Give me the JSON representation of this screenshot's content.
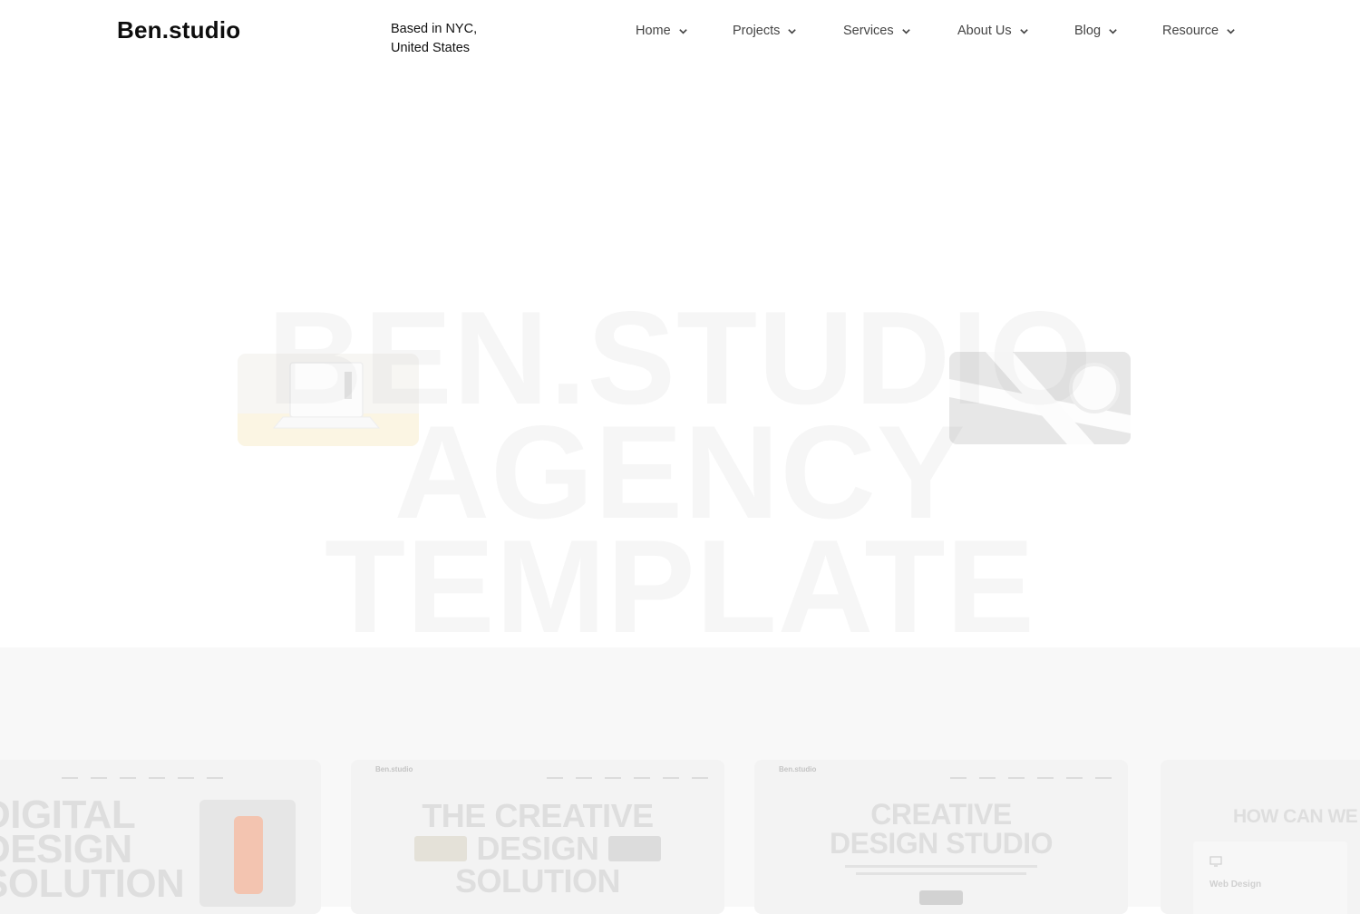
{
  "header": {
    "logo": "Ben.studio",
    "location_line1": "Based in NYC,",
    "location_line2": "United States"
  },
  "nav": [
    {
      "label": "Home"
    },
    {
      "label": "Projects"
    },
    {
      "label": "Services"
    },
    {
      "label": "About Us"
    },
    {
      "label": "Blog"
    },
    {
      "label": "Resource"
    }
  ],
  "hero": {
    "line1": "BEN.STUDIO",
    "line2": "AGENCY",
    "line3": "TEMPLATE"
  },
  "thumbnails": [
    {
      "heading": [
        "DIGITAL",
        "DESIGN",
        "SOLUTION"
      ]
    },
    {
      "logo": "Ben.studio",
      "heading": [
        "THE CREATIVE",
        "DESIGN",
        "SOLUTION"
      ]
    },
    {
      "logo": "Ben.studio",
      "heading": [
        "CREATIVE",
        "DESIGN STUDIO"
      ]
    },
    {
      "heading": [
        "HOW CAN WE H"
      ],
      "item": "Web Design"
    }
  ],
  "colors": {
    "background": "#ffffff",
    "hero_text": "#f6f6f6",
    "band": "#f8f8f8"
  }
}
